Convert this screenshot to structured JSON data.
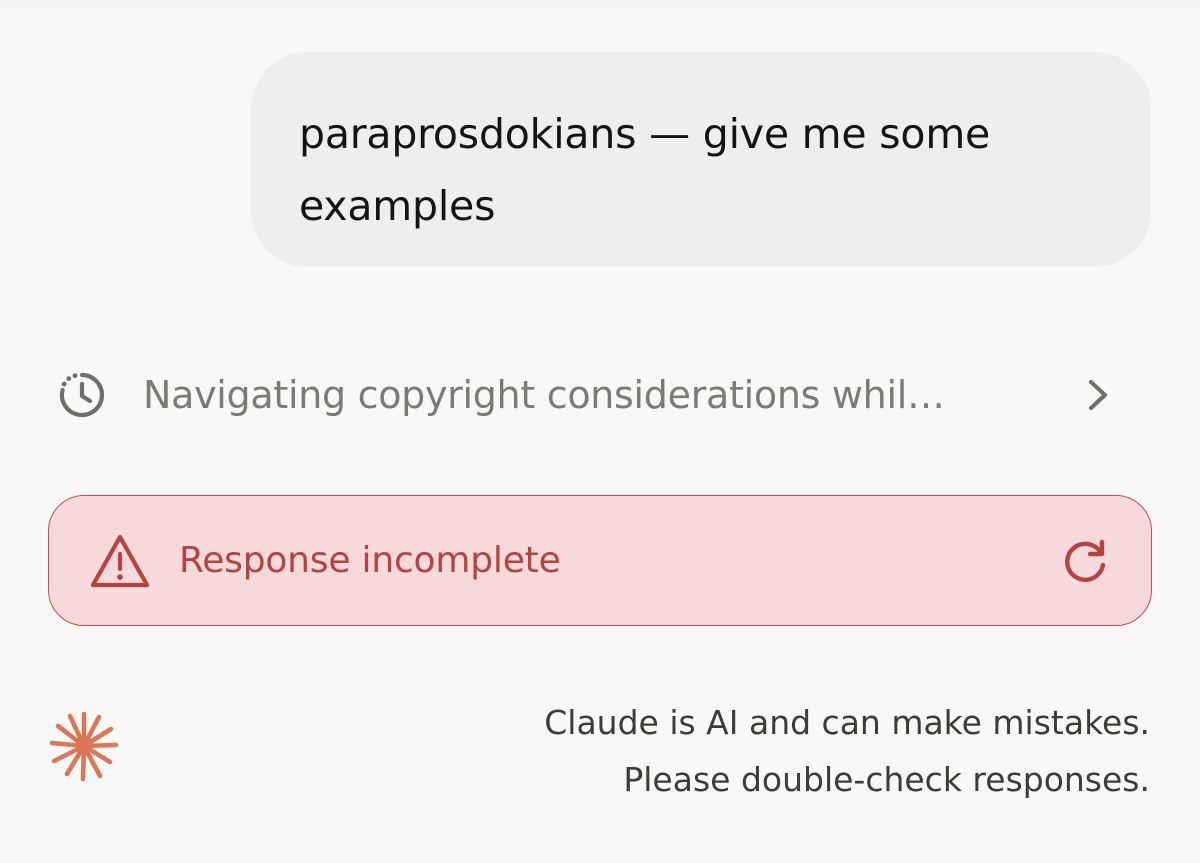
{
  "user_message": {
    "line1": "paraprosdokians — give me some",
    "line2": "examples"
  },
  "thinking": {
    "label": "Navigating copyright considerations whil…",
    "icon": "clock-history-icon",
    "expand_icon": "chevron-right-icon"
  },
  "error": {
    "label": "Response incomplete",
    "icon": "warning-triangle-icon",
    "retry_icon": "retry-icon"
  },
  "disclaimer": {
    "line1": "Claude is AI and can make mistakes.",
    "line2": "Please double-check responses."
  },
  "colors": {
    "background": "#f9f8f7",
    "bubble": "#efeeec",
    "error_bg": "#f6d9da",
    "error_text": "#b5433f",
    "brand": "#d97757"
  }
}
